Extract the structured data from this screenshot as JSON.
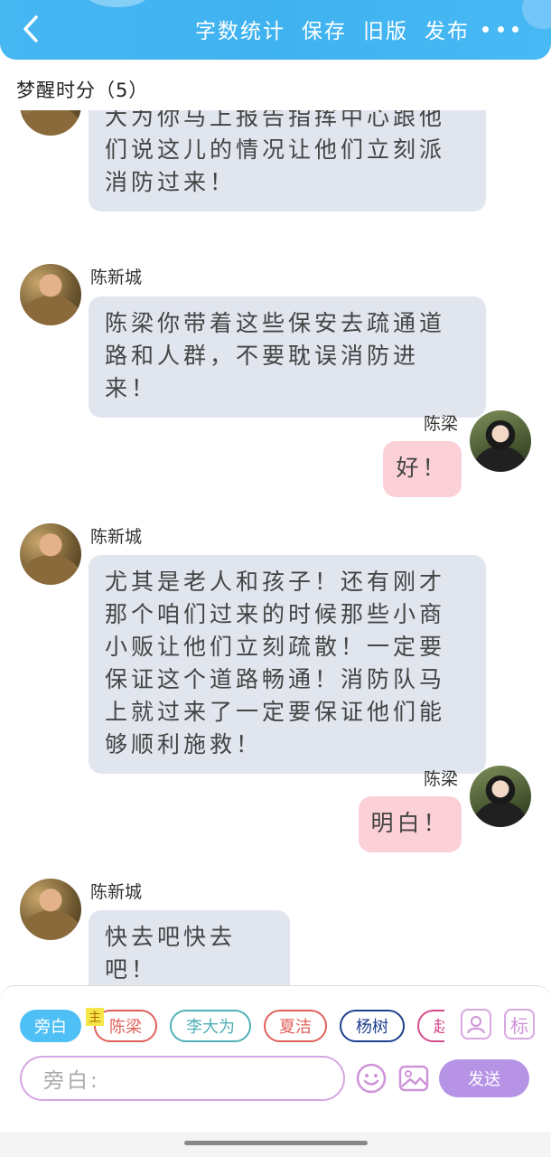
{
  "header": {
    "actions": [
      "字数统计",
      "保存",
      "旧版",
      "发布"
    ],
    "accent": "#47b7f2"
  },
  "chat": {
    "title": "梦醒时分（5）"
  },
  "messages": [
    {
      "side": "left",
      "sender": "",
      "avatar": "man",
      "text": "大为你马上报告指挥中心跟他们说这儿的情况让他们立刻派消防过来！"
    },
    {
      "side": "left",
      "sender": "陈新城",
      "avatar": "man",
      "text": "陈梁你带着这些保安去疏通道路和人群，不要耽误消防进来！"
    },
    {
      "side": "right",
      "sender": "陈梁",
      "avatar": "woman",
      "text": "好！"
    },
    {
      "side": "left",
      "sender": "陈新城",
      "avatar": "man",
      "text": "尤其是老人和孩子！还有刚才那个咱们过来的时候那些小商小贩让他们立刻疏散！一定要保证这个道路畅通！消防队马上就过来了一定要保证他们能够顺利施救！"
    },
    {
      "side": "right",
      "sender": "陈梁",
      "avatar": "woman",
      "text": "明白！"
    },
    {
      "side": "left",
      "sender": "陈新城",
      "avatar": "man",
      "text": "快去吧快去吧！"
    }
  ],
  "input": {
    "roles": [
      {
        "label": "旁白",
        "color": "#4fc0f5",
        "active": true
      },
      {
        "label": "陈梁",
        "color": "#e0605a",
        "active": false
      },
      {
        "label": "李大为",
        "color": "#4fb0b8",
        "active": false
      },
      {
        "label": "夏洁",
        "color": "#e0605a",
        "active": false
      },
      {
        "label": "杨树",
        "color": "#1f3f8f",
        "active": false
      },
      {
        "label": "赵",
        "color": "#d54a8a",
        "active": false
      }
    ],
    "main_tag": "主",
    "side_icons": [
      "person-icon",
      "标"
    ],
    "placeholder": "旁白:",
    "send_label": "发送",
    "send_color": "#b793e6"
  }
}
